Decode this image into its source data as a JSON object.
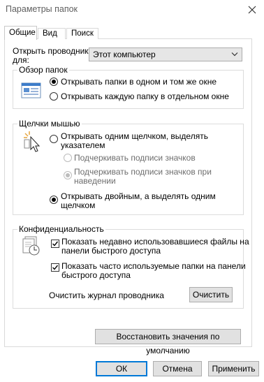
{
  "window": {
    "title": "Параметры папок",
    "close_icon": "close-icon"
  },
  "tabs": [
    {
      "label": "Общие",
      "active": true
    },
    {
      "label": "Вид",
      "active": false
    },
    {
      "label": "Поиск",
      "active": false
    }
  ],
  "general": {
    "open_explorer_label_line1": "Открыть проводник",
    "open_explorer_label_line2": "для:",
    "open_explorer_value": "Этот компьютер",
    "browse_folders": {
      "title": "Обзор папок",
      "option_same_window": "Открывать папки в одном и том же окне",
      "option_new_window": "Открывать каждую папку в отдельном окне",
      "selected": "same_window"
    },
    "click_items": {
      "title": "Щелчки мышью",
      "option_single_line1": "Открывать одним щелчком, выделять",
      "option_single_line2": "указателем",
      "sub_underline_all": "Подчеркивать подписи значков",
      "sub_underline_hover_line1": "Подчеркивать подписи значков при",
      "sub_underline_hover_line2": "наведении",
      "option_double_line1": "Открывать двойным, а выделять одним",
      "option_double_line2": "щелчком",
      "selected": "double"
    },
    "privacy": {
      "title": "Конфиденциальность",
      "show_recent_files_line1": "Показать недавно использовавшиеся файлы на",
      "show_recent_files_line2": "панели быстрого доступа",
      "show_frequent_folders_line1": "Показать часто используемые папки на панели",
      "show_frequent_folders_line2": "быстрого доступа",
      "recent_checked": true,
      "frequent_checked": true,
      "clear_history_label": "Очистить журнал проводника",
      "clear_button": "Очистить"
    },
    "restore_defaults_button": "Восстановить значения по умолчанию"
  },
  "footer": {
    "ok_button": "ОК",
    "cancel_button": "Отмена",
    "apply_button": "Применить"
  },
  "colors": {
    "accent": "#0078d7",
    "button_bg": "#e1e1e1",
    "border": "#dcdcdc",
    "disabled_text": "#6d6d6d"
  }
}
